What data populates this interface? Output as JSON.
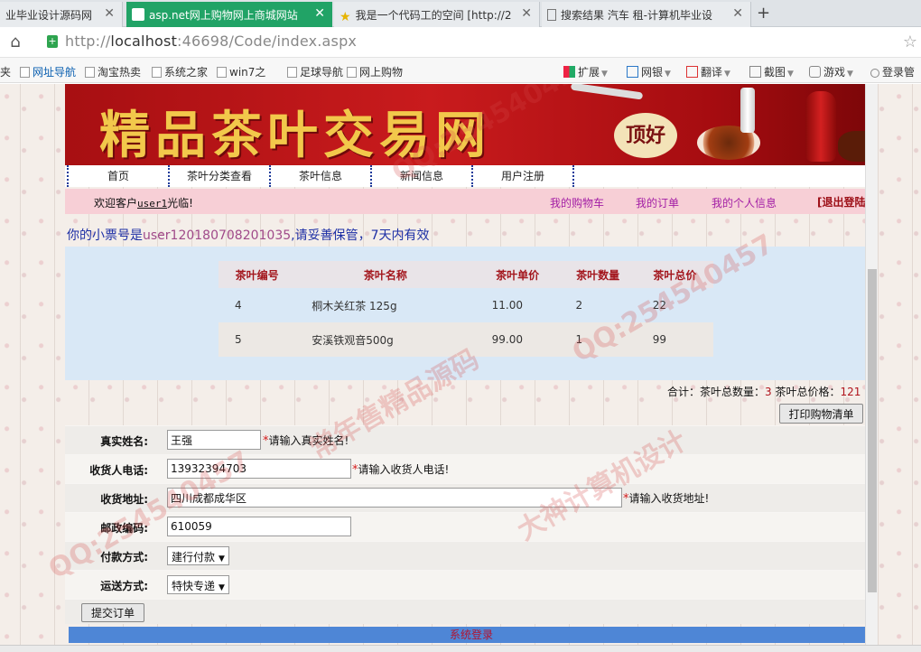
{
  "browser": {
    "tabs": [
      {
        "label": "业毕业设计源码网"
      },
      {
        "label": "asp.net网上购物网上商城网站"
      },
      {
        "label": "我是一个代码工的空间 [http://2"
      },
      {
        "label": "搜索结果 汽车 租-计算机毕业设"
      }
    ],
    "new_tab": "+",
    "url_prefix": "http://",
    "url_host": "localhost",
    "url_rest": ":46698/Code/index.aspx",
    "bookmarks": [
      "夹",
      "网址导航",
      "淘宝热卖",
      "系统之家",
      "win7之",
      "足球导航",
      "网上购物"
    ],
    "extensions": [
      "扩展",
      "网银",
      "翻译",
      "截图",
      "游戏",
      "登录管"
    ]
  },
  "site": {
    "banner_title": "精品茶叶交易网",
    "banner_badge": "顶好",
    "nav": [
      "首页",
      "茶叶分类查看",
      "茶叶信息",
      "新闻信息",
      "用户注册"
    ],
    "welcome_prefix": "欢迎客户",
    "username": "user1",
    "welcome_suffix": "光临!",
    "user_links": [
      "我的购物车",
      "我的订单",
      "我的个人信息"
    ],
    "logout": "[退出登陆]"
  },
  "ticket": {
    "prefix": "你的小票号是",
    "number": "user120180708201035",
    "suffix": ",请妥善保管，7天内有效"
  },
  "cart": {
    "columns": [
      "茶叶编号",
      "茶叶名称",
      "茶叶单价",
      "茶叶数量",
      "茶叶总价"
    ],
    "rows": [
      [
        "4",
        "桐木关红茶 125g",
        "11.00",
        "2",
        "22"
      ],
      [
        "5",
        "安溪铁观音500g",
        "99.00",
        "1",
        "99"
      ]
    ],
    "totals_label": "合计：",
    "qty_label": "茶叶总数量：",
    "qty": "3",
    "price_label": "茶叶总价格：",
    "price": "121",
    "print_button": "打印购物清单"
  },
  "form": {
    "name_label": "真实姓名:",
    "name_value": "王强",
    "name_hint": "请输入真实姓名!",
    "phone_label": "收货人电话:",
    "phone_value": "13932394703",
    "phone_hint": "请输入收货人电话!",
    "address_label": "收货地址:",
    "address_value": "四川成都成华区",
    "address_hint": "请输入收货地址!",
    "zip_label": "邮政编码:",
    "zip_value": "610059",
    "payment_label": "付款方式:",
    "payment_value": "建行付款",
    "shipping_label": "运送方式:",
    "shipping_value": "特快专递",
    "required_mark": "*",
    "submit_button": "提交订单"
  },
  "footer": {
    "text": "系统登录"
  },
  "watermarks": [
    "QQ:254540457",
    "常年售精品源码",
    "大神计算机设计"
  ],
  "colors": {
    "banner_red": "#c91b1d",
    "banner_gold": "#f2c84b",
    "active_tab": "#21a366",
    "footer_blue": "#4e86d6",
    "link_purple": "#a31ea5"
  }
}
